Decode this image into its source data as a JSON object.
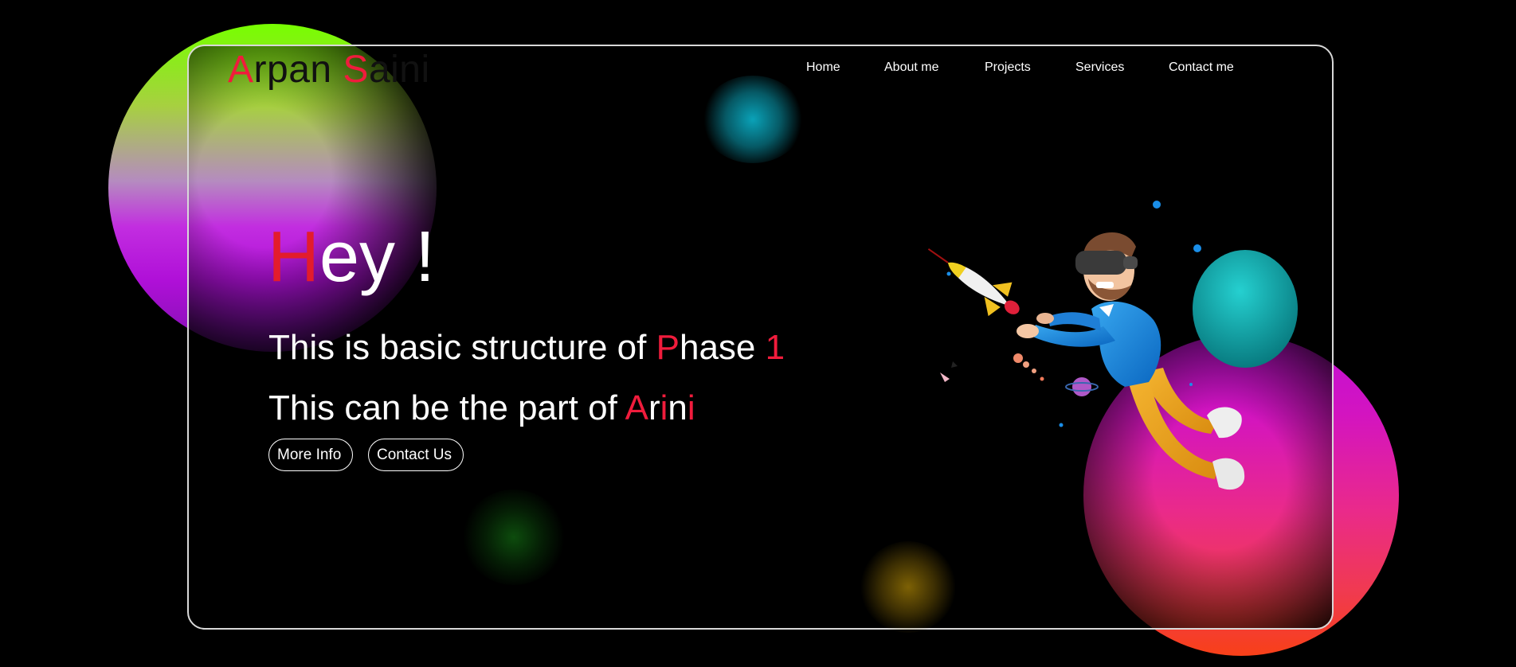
{
  "logo": {
    "parts": [
      {
        "text": "A",
        "accent": true
      },
      {
        "text": "rpan ",
        "accent": false
      },
      {
        "text": "S",
        "accent": true
      },
      {
        "text": "aini",
        "accent": false
      }
    ]
  },
  "nav": {
    "items": [
      "Home",
      "About me",
      "Projects",
      "Services",
      "Contact me"
    ]
  },
  "hero": {
    "greeting_first": "H",
    "greeting_rest": "ey !",
    "line1": {
      "prefix": "This is basic structure of ",
      "word_first": "P",
      "word_rest": "hase ",
      "number": "1"
    },
    "line2": {
      "prefix": "This can be the part of ",
      "w1": "A",
      "w2": "r",
      "w3": "i",
      "w4": "n",
      "w5": "i"
    }
  },
  "buttons": {
    "more_info": "More Info",
    "contact_us": "Contact Us"
  },
  "colors": {
    "background": "#000000",
    "accent": "#f01c3c",
    "text": "#ffffff",
    "card_border": "#d8d8d8"
  },
  "illustration": {
    "icon": "vr-man-with-rocket-illustration"
  }
}
